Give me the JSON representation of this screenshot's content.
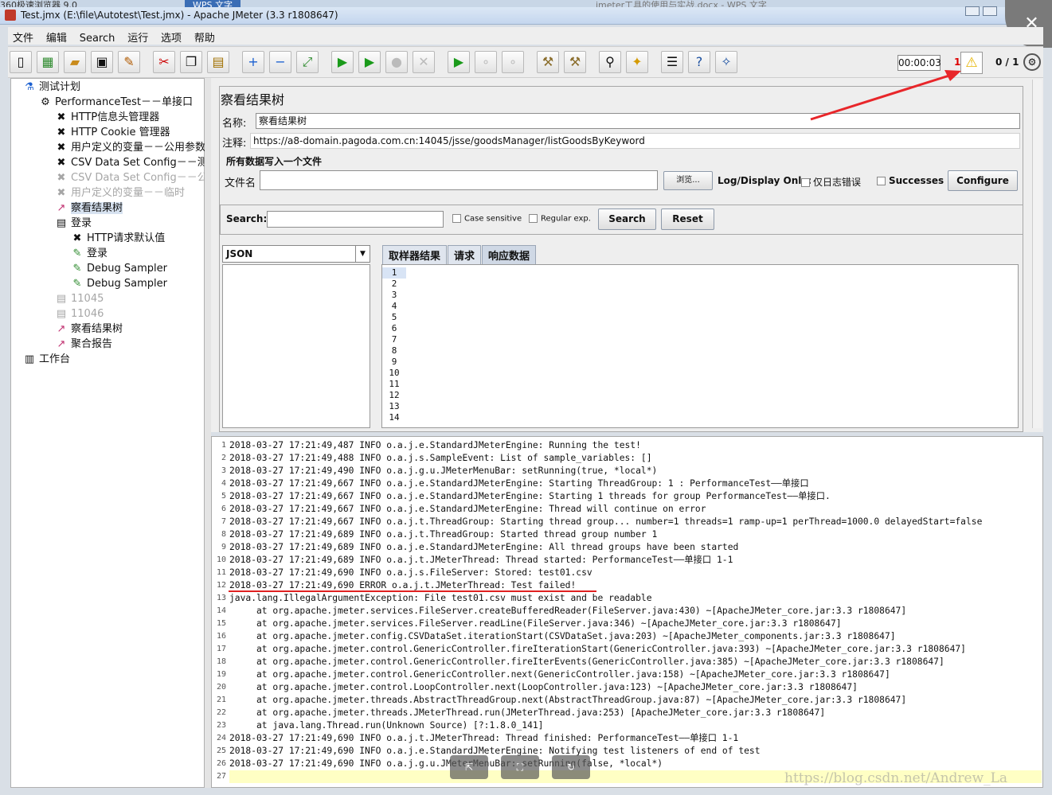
{
  "background": {
    "browser_label": "360极速浏览器 9.0",
    "wps_label": "WPS 文字",
    "doc_title": "jmeter工具的使用与实战.docx - WPS 文字"
  },
  "window": {
    "title": "Test.jmx (E:\\file\\Autotest\\Test.jmx) - Apache JMeter (3.3 r1808647)",
    "close_glyph": "✕"
  },
  "menu": [
    "文件",
    "编辑",
    "Search",
    "运行",
    "选项",
    "帮助"
  ],
  "toolbar": {
    "timer": "00:00:03",
    "warning_count": "1",
    "thread_count": "0 / 1"
  },
  "tree": [
    {
      "label": "测试计划",
      "icon": "flask-icon",
      "glyph": "⚗",
      "disabled": false,
      "selected": false
    },
    {
      "label": "PerformanceTest－－单接口",
      "icon": "gear-icon",
      "glyph": "⚙",
      "disabled": false,
      "selected": false
    },
    {
      "label": "HTTP信息头管理器",
      "icon": "wrench-icon",
      "glyph": "✖",
      "disabled": false,
      "selected": false
    },
    {
      "label": "HTTP Cookie 管理器",
      "icon": "wrench-icon",
      "glyph": "✖",
      "disabled": false,
      "selected": false
    },
    {
      "label": "用户定义的变量－－公用参数",
      "icon": "wrench-icon",
      "glyph": "✖",
      "disabled": false,
      "selected": false
    },
    {
      "label": "CSV Data Set Config－－测试",
      "icon": "wrench-icon",
      "glyph": "✖",
      "disabled": false,
      "selected": false
    },
    {
      "label": "CSV Data Set Config－－公用",
      "icon": "wrench-icon",
      "glyph": "✖",
      "disabled": true,
      "selected": false
    },
    {
      "label": "用户定义的变量－－临时",
      "icon": "wrench-icon",
      "glyph": "✖",
      "disabled": true,
      "selected": false
    },
    {
      "label": "察看结果树",
      "icon": "chart-icon",
      "glyph": "📈",
      "disabled": false,
      "selected": true
    },
    {
      "label": "登录",
      "icon": "controller-icon",
      "glyph": "▤",
      "disabled": false,
      "selected": false
    },
    {
      "label": "HTTP请求默认值",
      "icon": "wrench-icon",
      "glyph": "✖",
      "disabled": false,
      "selected": false
    },
    {
      "label": "登录",
      "icon": "pipette-icon",
      "glyph": "✎",
      "disabled": false,
      "selected": false
    },
    {
      "label": "Debug Sampler",
      "icon": "pipette-icon",
      "glyph": "✎",
      "disabled": false,
      "selected": false
    },
    {
      "label": "Debug Sampler",
      "icon": "pipette-icon",
      "glyph": "✎",
      "disabled": false,
      "selected": false
    },
    {
      "label": "11045",
      "icon": "controller-icon",
      "glyph": "▤",
      "disabled": true,
      "selected": false
    },
    {
      "label": "11046",
      "icon": "controller-icon",
      "glyph": "▤",
      "disabled": true,
      "selected": false
    },
    {
      "label": "察看结果树",
      "icon": "chart-icon",
      "glyph": "📈",
      "disabled": false,
      "selected": false
    },
    {
      "label": "聚合报告",
      "icon": "chart-icon",
      "glyph": "📈",
      "disabled": false,
      "selected": false
    },
    {
      "label": "工作台",
      "icon": "workbench-icon",
      "glyph": "▥",
      "disabled": false,
      "selected": false
    }
  ],
  "panel": {
    "title": "察看结果树",
    "name_label": "名称:",
    "name_value": "察看结果树",
    "comment_label": "注释:",
    "comment_value": "https://a8-domain.pagoda.com.cn:14045/jsse/goodsManager/listGoodsByKeyword",
    "section_label": "所有数据写入一个文件",
    "file_label": "文件名",
    "browse_label": "浏览...",
    "log_display_label": "Log/Display Only:",
    "errors_only_label": "仅日志错误",
    "successes_label": "Successes",
    "configure_label": "Configure",
    "search_label": "Search:",
    "search_value": "",
    "case_sensitive_label": "Case sensitive",
    "regex_label": "Regular exp.",
    "search_button": "Search",
    "reset_button": "Reset",
    "renderer": "JSON",
    "tabs": [
      "取样器结果",
      "请求",
      "响应数据"
    ],
    "active_tab": 2,
    "editor_lines": [
      "1",
      "2",
      "3",
      "4",
      "5",
      "6",
      "7",
      "8",
      "9",
      "10",
      "11",
      "12",
      "13",
      "14"
    ]
  },
  "log": {
    "line_numbers": [
      "1",
      "2",
      "3",
      "4",
      "5",
      "6",
      "7",
      "8",
      "9",
      "10",
      "11",
      "12",
      "13",
      "14",
      "15",
      "16",
      "17",
      "18",
      "19",
      "20",
      "21",
      "22",
      "23",
      "24",
      "25",
      "26",
      "27"
    ],
    "lines": [
      "2018-03-27 17:21:49,487 INFO o.a.j.e.StandardJMeterEngine: Running the test!",
      "2018-03-27 17:21:49,488 INFO o.a.j.s.SampleEvent: List of sample_variables: []",
      "2018-03-27 17:21:49,490 INFO o.a.j.g.u.JMeterMenuBar: setRunning(true, *local*)",
      "2018-03-27 17:21:49,667 INFO o.a.j.e.StandardJMeterEngine: Starting ThreadGroup: 1 : PerformanceTest——单接口",
      "2018-03-27 17:21:49,667 INFO o.a.j.e.StandardJMeterEngine: Starting 1 threads for group PerformanceTest——单接口.",
      "2018-03-27 17:21:49,667 INFO o.a.j.e.StandardJMeterEngine: Thread will continue on error",
      "2018-03-27 17:21:49,667 INFO o.a.j.t.ThreadGroup: Starting thread group... number=1 threads=1 ramp-up=1 perThread=1000.0 delayedStart=false",
      "2018-03-27 17:21:49,689 INFO o.a.j.t.ThreadGroup: Started thread group number 1",
      "2018-03-27 17:21:49,689 INFO o.a.j.e.StandardJMeterEngine: All thread groups have been started",
      "2018-03-27 17:21:49,689 INFO o.a.j.t.JMeterThread: Thread started: PerformanceTest——单接口 1-1",
      "2018-03-27 17:21:49,690 INFO o.a.j.s.FileServer: Stored: test01.csv",
      "2018-03-27 17:21:49,690 ERROR o.a.j.t.JMeterThread: Test failed!",
      "java.lang.IllegalArgumentException: File test01.csv must exist and be readable",
      "     at org.apache.jmeter.services.FileServer.createBufferedReader(FileServer.java:430) ~[ApacheJMeter_core.jar:3.3 r1808647]",
      "     at org.apache.jmeter.services.FileServer.readLine(FileServer.java:346) ~[ApacheJMeter_core.jar:3.3 r1808647]",
      "     at org.apache.jmeter.config.CSVDataSet.iterationStart(CSVDataSet.java:203) ~[ApacheJMeter_components.jar:3.3 r1808647]",
      "     at org.apache.jmeter.control.GenericController.fireIterationStart(GenericController.java:393) ~[ApacheJMeter_core.jar:3.3 r1808647]",
      "     at org.apache.jmeter.control.GenericController.fireIterEvents(GenericController.java:385) ~[ApacheJMeter_core.jar:3.3 r1808647]",
      "     at org.apache.jmeter.control.GenericController.next(GenericController.java:158) ~[ApacheJMeter_core.jar:3.3 r1808647]",
      "     at org.apache.jmeter.control.LoopController.next(LoopController.java:123) ~[ApacheJMeter_core.jar:3.3 r1808647]",
      "     at org.apache.jmeter.threads.AbstractThreadGroup.next(AbstractThreadGroup.java:87) ~[ApacheJMeter_core.jar:3.3 r1808647]",
      "     at org.apache.jmeter.threads.JMeterThread.run(JMeterThread.java:253) [ApacheJMeter_core.jar:3.3 r1808647]",
      "     at java.lang.Thread.run(Unknown Source) [?:1.8.0_141]",
      "2018-03-27 17:21:49,690 INFO o.a.j.t.JMeterThread: Thread finished: PerformanceTest——单接口 1-1",
      "2018-03-27 17:21:49,690 INFO o.a.j.e.StandardJMeterEngine: Notifying test listeners of end of test",
      "2018-03-27 17:21:49,690 INFO o.a.j.g.u.JMeterMenuBar: setRunning(false, *local*)",
      ""
    ]
  },
  "watermark": "https://blog.csdn.net/Andrew_La"
}
